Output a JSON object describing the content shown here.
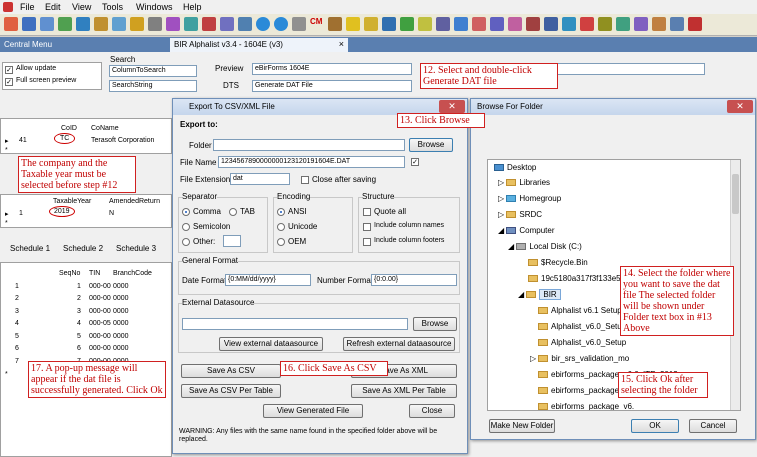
{
  "menu": [
    "File",
    "Edit",
    "View",
    "Tools",
    "Windows",
    "Help"
  ],
  "toolbar_icon_text": "CM",
  "tabs": {
    "central": "Central Menu",
    "alphalist": "BIR Alphalist v3.4 - 1604E (v3)",
    "close": "×"
  },
  "left": {
    "allow_update": "Allow update",
    "full_screen": "Full screen preview",
    "search_label": "Search",
    "search_field": "ColumnToSearch",
    "search_string": "SearchString"
  },
  "preview": {
    "label": "Preview",
    "value": "eBirForms 1604E",
    "dts_label": "DTS",
    "dts_value": "Generate DAT File"
  },
  "company_grid": {
    "col_coid": "CoID",
    "col_coname": "CoName",
    "row_num": "41",
    "coid": "TC",
    "coname": "Terasoft Corporation",
    "new_row": "*"
  },
  "year_grid": {
    "col_year": "TaxableYear",
    "col_amended": "AmendedReturn",
    "row_num": "1",
    "year": "2019",
    "amended": "N",
    "new_row": "*"
  },
  "schedule_tabs": [
    "Schedule 1",
    "Schedule 2",
    "Schedule 3"
  ],
  "schedule_grid": {
    "cols": [
      "SeqNo",
      "TIN",
      "BranchCode"
    ],
    "rows": [
      [
        "1",
        "1",
        "000-00",
        "0000"
      ],
      [
        "2",
        "2",
        "000-00",
        "0000"
      ],
      [
        "3",
        "3",
        "000-00",
        "0000"
      ],
      [
        "4",
        "4",
        "000-05",
        "0000"
      ],
      [
        "5",
        "5",
        "000-00",
        "0000"
      ],
      [
        "6",
        "6",
        "000-00",
        "0000"
      ],
      [
        "7",
        "7",
        "000-00",
        "0000"
      ]
    ],
    "new_row": "*"
  },
  "export_dialog": {
    "title": "Export To CSV/XML File",
    "export_to": "Export to:",
    "folder_label": "Folder",
    "browse": "Browse",
    "filename_label": "File Name",
    "filename": "1234567890000000123120191604E.DAT",
    "ext_label": "File Extension",
    "ext": "dat",
    "close_after": "Close after saving",
    "separator": "Separator",
    "comma": "Comma",
    "tab": "TAB",
    "semicolon": "Semicolon",
    "other": "Other:",
    "encoding": "Encoding",
    "ansi": "ANSI",
    "unicode": "Unicode",
    "oem": "OEM",
    "structure": "Structure",
    "quote_all": "Quote all",
    "incl_col_names": "Include column names",
    "incl_col_footers": "Include column footers",
    "general_format": "General Format",
    "date_format_label": "Date Format",
    "date_format": "{0:MM/dd/yyyy}",
    "number_format_label": "Number Format",
    "number_format": "{0:0.00}",
    "ext_ds": "External Datasource",
    "browse2": "Browse",
    "view_ext_ds": "View external dataasource",
    "refresh_ext_ds": "Refresh external dataasource",
    "save_csv": "Save As CSV",
    "save_xml": "Save As XML",
    "save_csv_table": "Save As CSV Per Table",
    "save_xml_table": "Save As XML Per Table",
    "view_generated": "View Generated File",
    "close": "Close",
    "warning": "WARNING: Any files with the same name found in the specified folder above will be replaced."
  },
  "browse_dialog": {
    "title": "Browse For Folder",
    "tree": [
      "Desktop",
      "Libraries",
      "Homegroup",
      "SRDC",
      "Computer",
      "Local Disk (C:)",
      "$Recycle.Bin",
      "19c5180a317f3f133e5e",
      "BIR",
      "Alphalist v6.1 Setup",
      "Alphalist_v6.0_Setup",
      "Alphalist_v6.0_Setup",
      "bir_srs_validation_mo",
      "ebirforms_package_v6.6_ITRv2013",
      "ebirforms_package_v6.",
      "ebirforms_package_v6."
    ],
    "make_new": "Make New Folder",
    "ok": "OK",
    "cancel": "Cancel"
  },
  "callouts": {
    "c12": "12. Select and double-click Generate DAT file",
    "c13": "13. Click Browse",
    "c_company": "The company and the Taxable year must be selected before step #12",
    "c14": "14. Select the folder where you want to save the dat file The selected folder will be shown under Folder text box in #13 Above",
    "c15": "15. Click Ok after selecting the folder",
    "c16": "16. Click Save As CSV",
    "c17": "17. A pop-up message will appear if the dat file is successfully generated. Click Ok"
  }
}
